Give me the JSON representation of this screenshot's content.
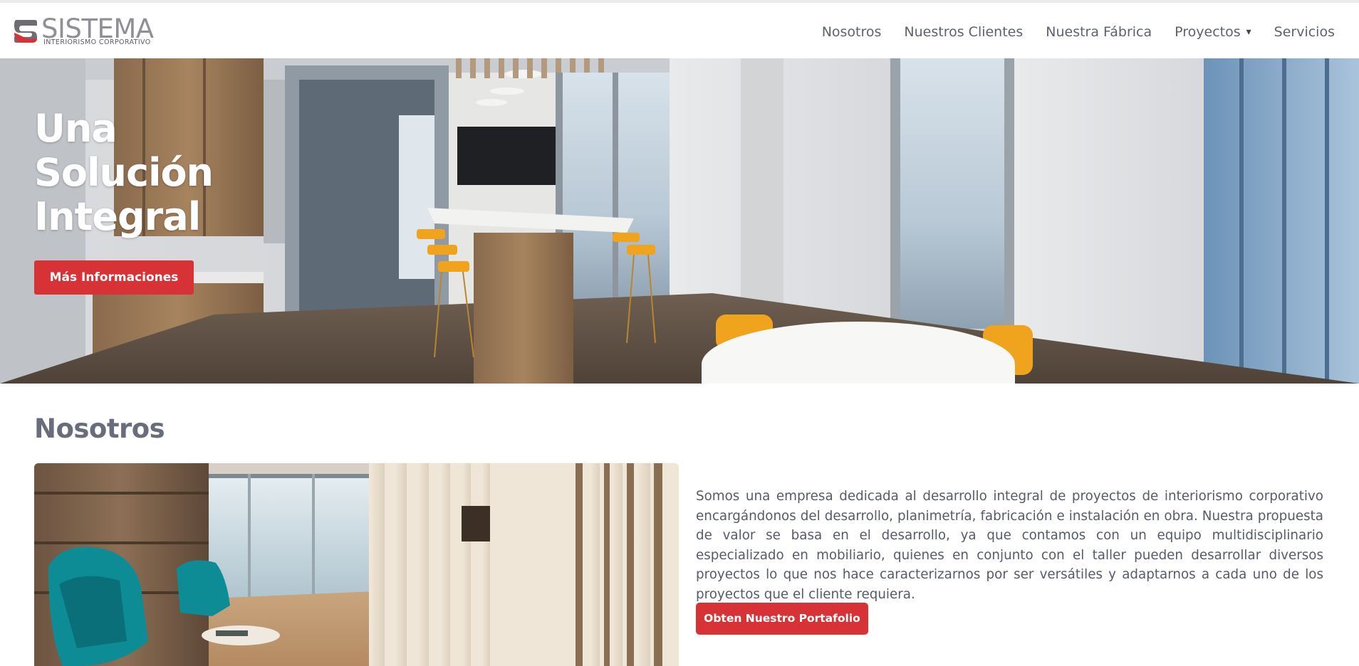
{
  "brand": {
    "name": "SISTEMA",
    "tagline": "INTERIORISMO CORPORATIVO",
    "accent_color": "#d73336",
    "text_color": "#5c6270"
  },
  "nav": {
    "items": [
      {
        "label": "Nosotros"
      },
      {
        "label": "Nuestros Clientes"
      },
      {
        "label": "Nuestra Fábrica"
      },
      {
        "label": "Proyectos",
        "icon": "caret-down-icon",
        "caret": "▾"
      },
      {
        "label": "Servicios"
      }
    ]
  },
  "hero": {
    "title_lines": [
      "Una",
      "Solución",
      "Integral"
    ],
    "button_label": "Más Informaciones",
    "image": "office-kitchen-photo"
  },
  "about": {
    "title": "Nosotros",
    "image": "office-lounge-photo",
    "paragraph": "Somos una empresa dedicada al desarrollo integral de proyectos de interiorismo corporativo encargándonos del desarrollo, planimetría, fabricación e instalación en obra. Nuestra propuesta de valor se basa en el desarrollo, ya que contamos con un equipo multidisciplinario especializado en mobiliario, quienes en conjunto con el taller pueden desarrollar diversos proyectos lo que nos hace caracterizarnos por ser versátiles y adaptarnos a cada uno de los proyectos que el cliente requiera.",
    "button_label": "Obten Nuestro Portafolio"
  }
}
